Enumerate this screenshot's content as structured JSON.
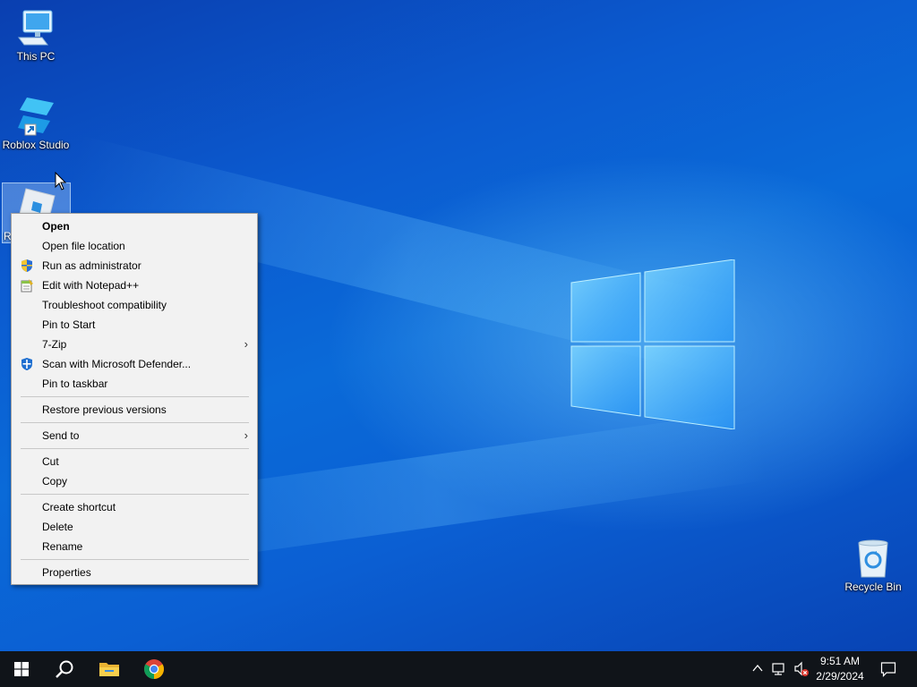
{
  "desktop": {
    "icons": {
      "this_pc": "This PC",
      "roblox_studio": "Roblox Studio",
      "roblox_partial": "R",
      "recycle_bin": "Recycle Bin"
    }
  },
  "context_menu": {
    "open": "Open",
    "open_file_location": "Open file location",
    "run_as_admin": "Run as administrator",
    "edit_notepadpp": "Edit with Notepad++",
    "troubleshoot": "Troubleshoot compatibility",
    "pin_start": "Pin to Start",
    "seven_zip": "7-Zip",
    "scan_defender": "Scan with Microsoft Defender...",
    "pin_taskbar": "Pin to taskbar",
    "restore_versions": "Restore previous versions",
    "send_to": "Send to",
    "cut": "Cut",
    "copy": "Copy",
    "create_shortcut": "Create shortcut",
    "delete": "Delete",
    "rename": "Rename",
    "properties": "Properties",
    "submenu_arrow": "›"
  },
  "taskbar": {
    "time": "9:51 AM",
    "date": "2/29/2024",
    "icons": [
      "start-icon",
      "search-icon",
      "file-explorer-icon",
      "chrome-icon",
      "chevron-up-icon",
      "network-icon",
      "volume-muted-icon",
      "notification-icon"
    ]
  },
  "colors": {
    "accent": "#0a6ad8",
    "menu_bg": "#f2f2f2",
    "taskbar_bg": "#101419"
  }
}
